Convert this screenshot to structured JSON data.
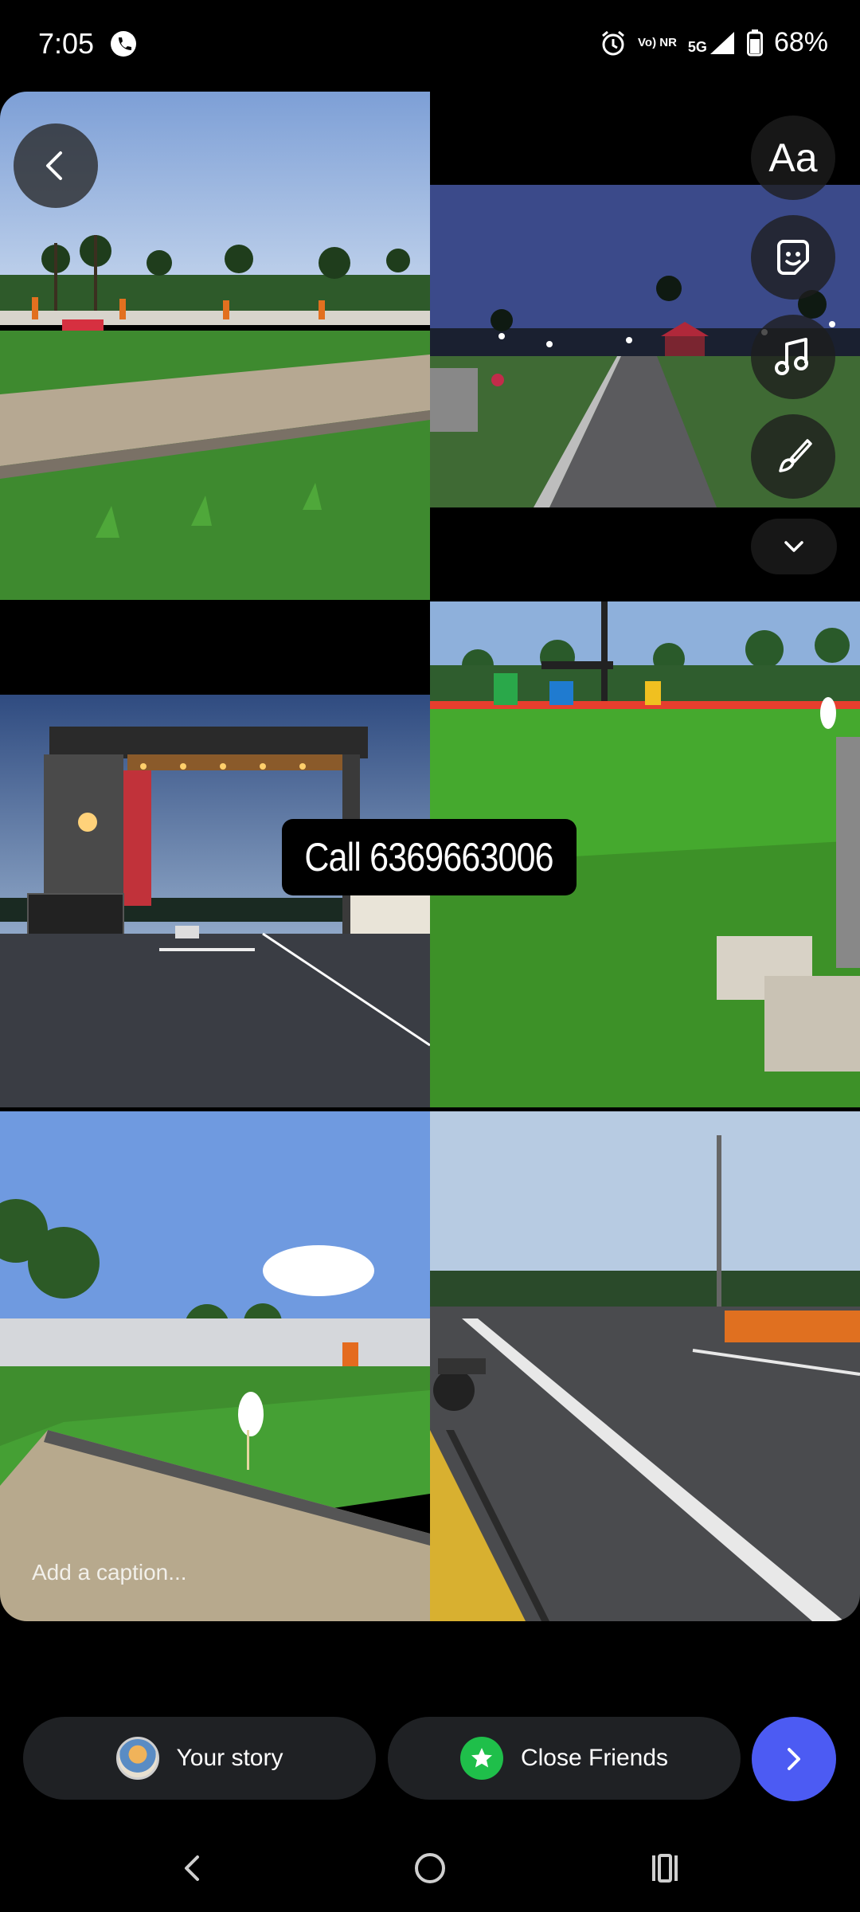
{
  "status_bar": {
    "time": "7:05",
    "app_icon": "phone-call-icon",
    "icons": [
      "alarm-icon",
      "volte-nr-icon",
      "5g-signal-icon",
      "battery-icon"
    ],
    "network": "5G",
    "volte_label": "Vo) NR",
    "battery": "68%"
  },
  "editor": {
    "back_icon": "chevron-left-icon",
    "tools": [
      {
        "label": "Aa",
        "icon": "text-icon"
      },
      {
        "label": "",
        "icon": "sticker-icon"
      },
      {
        "label": "",
        "icon": "music-icon"
      },
      {
        "label": "",
        "icon": "draw-icon"
      }
    ],
    "more_icon": "chevron-down-icon",
    "sticker_text": "Call 6369663006",
    "caption_placeholder": "Add a caption..."
  },
  "share": {
    "your_story_label": "Your story",
    "close_friends_label": "Close Friends",
    "next_icon": "chevron-right-icon"
  },
  "colors": {
    "accent": "#4c5bf3",
    "close_friends": "#1fbf4a",
    "pill_bg": "#1f2124"
  }
}
